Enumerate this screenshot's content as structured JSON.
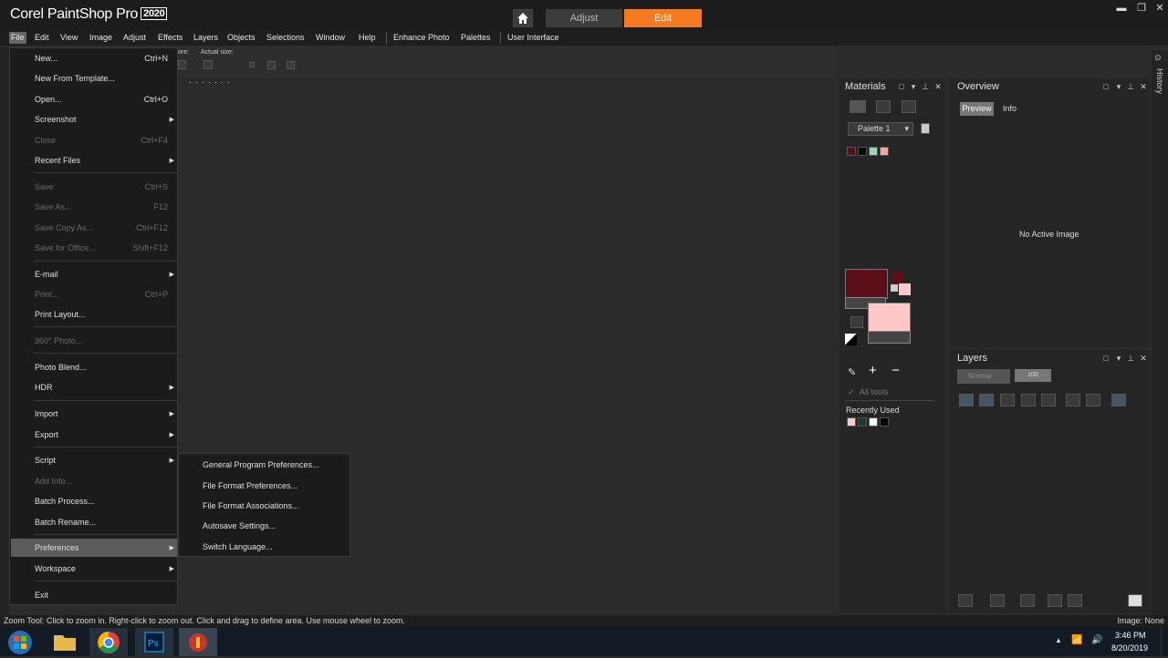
{
  "app": {
    "logo": "Corel PaintShop Pro",
    "year": "2020"
  },
  "tabs": {
    "adjust": "Adjust",
    "edit": "Edit"
  },
  "menubar": [
    "File",
    "Edit",
    "View",
    "Image",
    "Adjust",
    "Effects",
    "Layers",
    "Objects",
    "Selections",
    "Window",
    "Help",
    "Enhance Photo",
    "Palettes",
    "User Interface"
  ],
  "tool_options": {
    "zoom_label": "ore:",
    "actual_size_label": "Actual size:"
  },
  "file_menu": {
    "new": "New...",
    "new_shortcut": "Ctrl+N",
    "new_template": "New From Template...",
    "open": "Open...",
    "open_shortcut": "Ctrl+O",
    "screenshot": "Screenshot",
    "close": "Close",
    "close_shortcut": "Ctrl+F4",
    "recent_files": "Recent Files",
    "save": "Save",
    "save_shortcut": "Ctrl+S",
    "save_as": "Save As...",
    "save_as_shortcut": "F12",
    "save_copy_as": "Save Copy As...",
    "save_copy_as_shortcut": "Ctrl+F12",
    "save_for_office": "Save for Office...",
    "save_for_office_shortcut": "Shift+F12",
    "email": "E-mail",
    "print": "Print...",
    "print_shortcut": "Ctrl+P",
    "print_layout": "Print Layout...",
    "photo_360": "360° Photo...",
    "photo_blend": "Photo Blend...",
    "hdr": "HDR",
    "import": "Import",
    "export": "Export",
    "script": "Script",
    "add_info": "Add Info...",
    "batch_process": "Batch Process...",
    "batch_rename": "Batch Rename...",
    "preferences": "Preferences",
    "workspace": "Workspace",
    "exit": "Exit"
  },
  "pref_submenu": [
    "General Program Preferences...",
    "File Format Preferences...",
    "File Format Associations...",
    "Autosave Settings...",
    "Switch Language..."
  ],
  "materials": {
    "title": "Materials",
    "palette": "Palette 1",
    "all_tools": "All tools",
    "recently_used": "Recently Used",
    "fg_color": "#5a0f19",
    "bg_color": "#ffc8c8",
    "swatches": [
      "#5a0f19",
      "#000000",
      "#9fd4b4",
      "#f4a6a6"
    ],
    "recent": [
      "#ffc8c8",
      "#1f3a2a",
      "#ffffff",
      "#000000"
    ]
  },
  "overview": {
    "title": "Overview",
    "tab_preview": "Preview",
    "tab_info": "Info",
    "empty": "No Active Image"
  },
  "layers": {
    "title": "Layers",
    "blend_mode": "Normal",
    "opacity": "100"
  },
  "history_label": "History",
  "status": {
    "left": "Zoom Tool: Click to zoom in. Right-click to zoom out. Click and drag to define area. Use mouse wheel to zoom.",
    "right": "Image: None"
  },
  "taskbar": {
    "time": "3:46 PM",
    "date": "8/20/2019"
  }
}
